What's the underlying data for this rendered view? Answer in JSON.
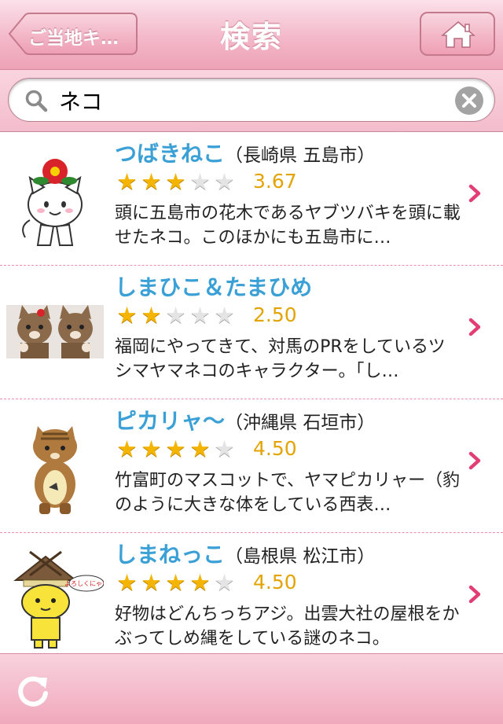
{
  "nav": {
    "back_label": "ご当地キ…",
    "title": "検索"
  },
  "search": {
    "value": "ネコ",
    "placeholder": ""
  },
  "results": [
    {
      "name": "つばきねこ",
      "location": "（長崎県 五島市）",
      "rating": 3.67,
      "score_label": "3.67",
      "desc": "頭に五島市の花木であるヤブツバキを頭に載せたネコ。このほかにも五島市に…"
    },
    {
      "name": "しまひこ＆たまひめ",
      "location": "",
      "rating": 2.5,
      "score_label": "2.50",
      "desc": "福岡にやってきて、対馬のPRをしているツシマヤマネコのキャラクター。「し…"
    },
    {
      "name": "ピカリャ〜",
      "location": "（沖縄県 石垣市）",
      "rating": 4.5,
      "score_label": "4.50",
      "desc": "竹富町のマスコットで、ヤマピカリャー（豹のように大きな体をしている西表…"
    },
    {
      "name": "しまねっこ",
      "location": "（島根県 松江市）",
      "rating": 4.5,
      "score_label": "4.50",
      "desc": "好物はどんちっちアジ。出雲大社の屋根をかぶってしめ縄をしている謎のネコ。"
    }
  ],
  "thumb4_bubble": "よろしくにゃ！",
  "colors": {
    "accent_pink": "#f3b8c9",
    "name_blue": "#3aa0d6",
    "score_gold": "#e3a300",
    "chevron_pink": "#e23e74"
  }
}
